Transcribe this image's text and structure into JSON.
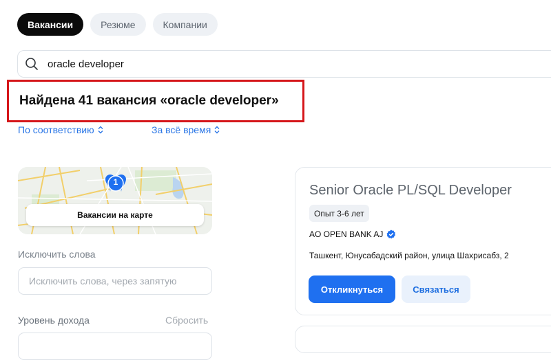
{
  "tabs": [
    {
      "label": "Вакансии",
      "active": true
    },
    {
      "label": "Резюме",
      "active": false
    },
    {
      "label": "Компании",
      "active": false
    }
  ],
  "search": {
    "value": "oracle developer",
    "icon": "search-icon"
  },
  "results": {
    "title": "Найдена 41 вакансия «oracle developer»"
  },
  "sorting": {
    "relevance": "По соответствию",
    "period": "За всё время"
  },
  "map": {
    "marker_count": "1",
    "button_label": "Вакансии на карте"
  },
  "filters": {
    "exclude_words": {
      "label": "Исключить слова",
      "placeholder": "Исключить слова, через запятую"
    },
    "income": {
      "label": "Уровень дохода",
      "reset_label": "Сбросить"
    }
  },
  "vacancy": {
    "title": "Senior Oracle PL/SQL Developer",
    "experience": "Опыт 3-6 лет",
    "company": "AO OPEN BANK AJ",
    "verified_icon": "verified-check-icon",
    "address": "Ташкент, Юнусабадский район, улица Шахрисабз, 2",
    "apply_label": "Откликнуться",
    "contact_label": "Связаться"
  },
  "colors": {
    "accent": "#1f70f0",
    "highlight_border": "#d5161a",
    "link": "#2a76e6"
  }
}
